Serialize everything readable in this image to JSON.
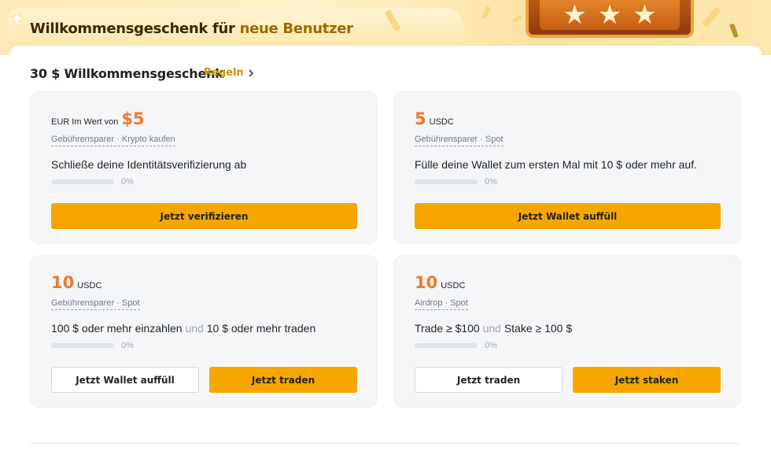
{
  "banner": {
    "title_main": "Willkommensgeschenk für ",
    "title_accent": "neue Benutzer"
  },
  "section": {
    "title": "30 $ Willkommensgeschenk",
    "rules_label": "Regeln"
  },
  "colors": {
    "accent_orange": "#f0782e",
    "button_yellow": "#f7a600",
    "rules_gold": "#c99400"
  },
  "cards": [
    {
      "prefix": "EUR Im Wert von",
      "amount": "$5",
      "unit": "",
      "tags": "Gebührensparer · Krypto kaufen",
      "task": [
        "Schließe deine Identitätsverifizierung ab"
      ],
      "task_connector": "",
      "progress": 0,
      "progress_label": "0%",
      "buttons": [
        "Jetzt verifizieren"
      ]
    },
    {
      "prefix": "",
      "amount": "5",
      "unit": "USDC",
      "tags": "Gebührensparer · Spot",
      "task": [
        "Fülle deine Wallet zum ersten Mal mit 10 $ oder mehr auf."
      ],
      "task_connector": "",
      "progress": 0,
      "progress_label": "0%",
      "buttons": [
        "Jetzt Wallet auffüll"
      ]
    },
    {
      "prefix": "",
      "amount": "10",
      "unit": "USDC",
      "tags": "Gebührensparer · Spot",
      "task": [
        "100 $ oder mehr einzahlen",
        "10 $ oder mehr traden"
      ],
      "task_connector": "und",
      "progress": 0,
      "progress_label": "0%",
      "buttons": [
        "Jetzt Wallet auffüll",
        "Jetzt traden"
      ]
    },
    {
      "prefix": "",
      "amount": "10",
      "unit": "USDC",
      "tags": "Airdrop · Spot",
      "task": [
        "Trade ≥ $100",
        "Stake ≥ 100 $"
      ],
      "task_connector": "und",
      "progress": 0,
      "progress_label": "0%",
      "buttons": [
        "Jetzt traden",
        "Jetzt staken"
      ]
    }
  ]
}
